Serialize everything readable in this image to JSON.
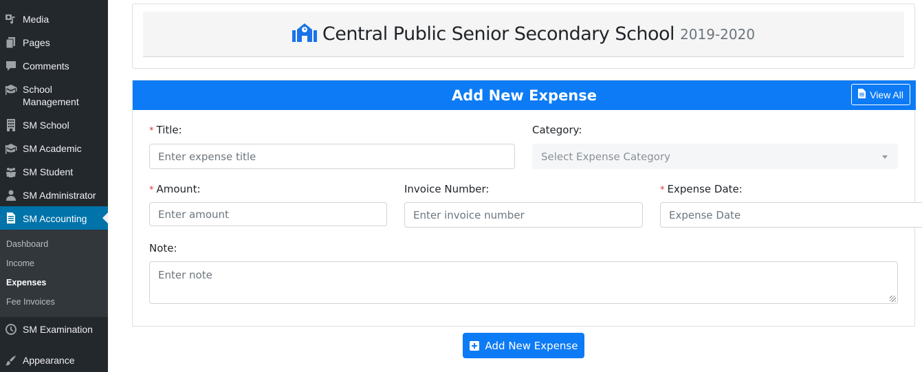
{
  "sidebar": {
    "items": [
      {
        "label": "Media",
        "icon": "media-icon"
      },
      {
        "label": "Pages",
        "icon": "pages-icon"
      },
      {
        "label": "Comments",
        "icon": "comments-icon"
      },
      {
        "label": "School Management",
        "icon": "graduation-cap-icon"
      },
      {
        "label": "SM School",
        "icon": "building-icon"
      },
      {
        "label": "SM Academic",
        "icon": "graduation-cap-icon"
      },
      {
        "label": "SM Student",
        "icon": "users-icon"
      },
      {
        "label": "SM Administrator",
        "icon": "user-icon"
      },
      {
        "label": "SM Accounting",
        "icon": "document-icon",
        "active": true
      },
      {
        "label": "SM Examination",
        "icon": "clock-icon"
      },
      {
        "label": "Appearance",
        "icon": "paintbrush-icon"
      }
    ],
    "submenu": [
      {
        "label": "Dashboard"
      },
      {
        "label": "Income"
      },
      {
        "label": "Expenses",
        "current": true
      },
      {
        "label": "Fee Invoices"
      }
    ]
  },
  "school": {
    "name": "Central Public Senior Secondary School",
    "session": "2019-2020"
  },
  "form": {
    "title": "Add New Expense",
    "view_all_label": "View All",
    "fields": {
      "title": {
        "label": "Title:",
        "required": "*",
        "placeholder": "Enter expense title",
        "value": ""
      },
      "category": {
        "label": "Category:",
        "placeholder": "Select Expense Category",
        "value": ""
      },
      "amount": {
        "label": "Amount:",
        "required": "*",
        "placeholder": "Enter amount",
        "value": ""
      },
      "invoice_number": {
        "label": "Invoice Number:",
        "placeholder": "Enter invoice number",
        "value": ""
      },
      "expense_date": {
        "label": "Expense Date:",
        "required": "*",
        "placeholder": "Expense Date",
        "value": ""
      },
      "note": {
        "label": "Note:",
        "placeholder": "Enter note",
        "value": ""
      }
    },
    "submit_label": "Add New Expense"
  },
  "colors": {
    "primary": "#0d7bf5",
    "sidebar_bg": "#23282d",
    "sidebar_active": "#0073aa",
    "required": "#dc3545"
  }
}
